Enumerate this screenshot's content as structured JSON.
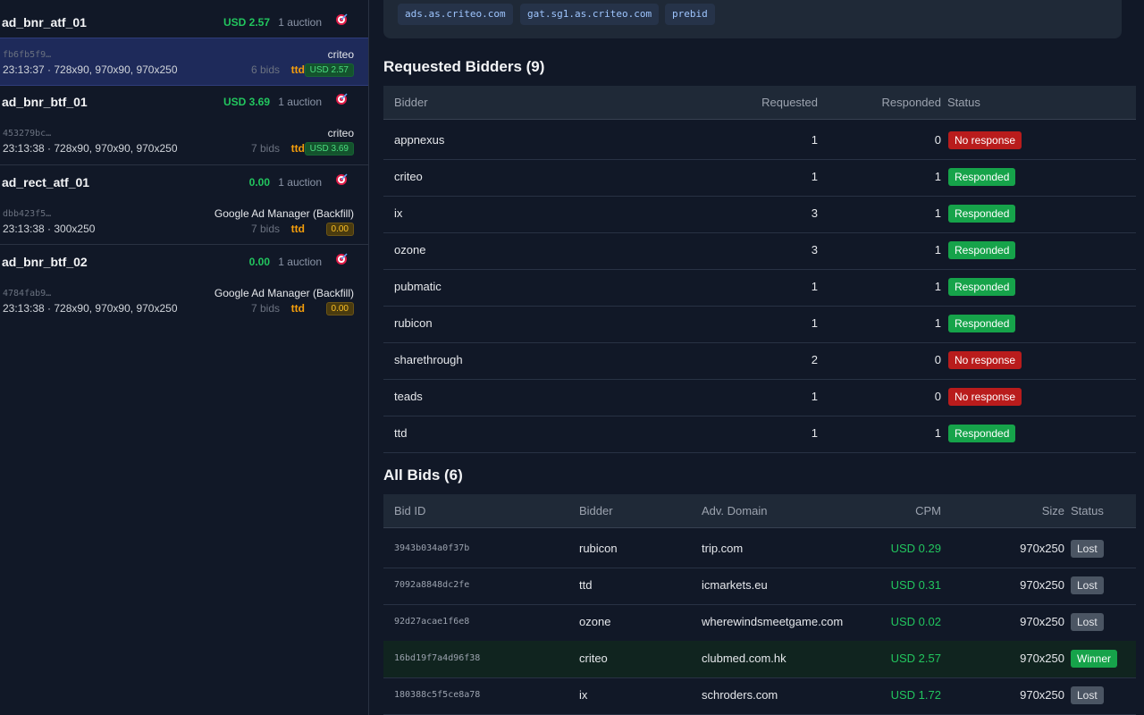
{
  "colors": {
    "background": "#111827",
    "panel": "#1f2937",
    "selected": "#1e2a5a",
    "accent_green": "#22c55e",
    "accent_orange": "#f59e0b",
    "danger": "#b91c1c"
  },
  "sidebar": {
    "slots": [
      {
        "name": "ad_bnr_atf_01",
        "price": "USD 2.57",
        "auctions": "1 auction",
        "icon": "target-icon",
        "auction": {
          "id": "fb6fb5f9…",
          "winner": "criteo",
          "meta": "23:13:37 · 728x90, 970x90, 970x250",
          "bids": "6 bids",
          "top_bidder": "ttd",
          "top_value": "USD 2.57"
        }
      },
      {
        "name": "ad_bnr_btf_01",
        "price": "USD 3.69",
        "auctions": "1 auction",
        "icon": "target-icon",
        "auction": {
          "id": "453279bc…",
          "winner": "criteo",
          "meta": "23:13:38 · 728x90, 970x90, 970x250",
          "bids": "7 bids",
          "top_bidder": "ttd",
          "top_value": "USD 3.69"
        }
      },
      {
        "name": "ad_rect_atf_01",
        "price": "0.00",
        "auctions": "1 auction",
        "icon": "target-icon",
        "auction": {
          "id": "dbb423f5…",
          "winner": "Google Ad Manager (Backfill)",
          "meta": "23:13:38 · 300x250",
          "bids": "7 bids",
          "top_bidder": "ttd",
          "top_value": "0.00"
        }
      },
      {
        "name": "ad_bnr_btf_02",
        "price": "0.00",
        "auctions": "1 auction",
        "icon": "target-icon",
        "auction": {
          "id": "4784fab9…",
          "winner": "Google Ad Manager (Backfill)",
          "meta": "23:13:38 · 728x90, 970x90, 970x250",
          "bids": "7 bids",
          "top_bidder": "ttd",
          "top_value": "0.00"
        }
      }
    ]
  },
  "domains": [
    "ads.as.criteo.com",
    "gat.sg1.as.criteo.com",
    "prebid"
  ],
  "requested_bidders": {
    "title": "Requested Bidders (9)",
    "headers": {
      "bidder": "Bidder",
      "requested": "Requested",
      "responded": "Responded",
      "status": "Status"
    },
    "rows": [
      {
        "bidder": "appnexus",
        "requested": "1",
        "responded": "0",
        "status": "No response",
        "ok": false
      },
      {
        "bidder": "criteo",
        "requested": "1",
        "responded": "1",
        "status": "Responded",
        "ok": true
      },
      {
        "bidder": "ix",
        "requested": "3",
        "responded": "1",
        "status": "Responded",
        "ok": true
      },
      {
        "bidder": "ozone",
        "requested": "3",
        "responded": "1",
        "status": "Responded",
        "ok": true
      },
      {
        "bidder": "pubmatic",
        "requested": "1",
        "responded": "1",
        "status": "Responded",
        "ok": true
      },
      {
        "bidder": "rubicon",
        "requested": "1",
        "responded": "1",
        "status": "Responded",
        "ok": true
      },
      {
        "bidder": "sharethrough",
        "requested": "2",
        "responded": "0",
        "status": "No response",
        "ok": false
      },
      {
        "bidder": "teads",
        "requested": "1",
        "responded": "0",
        "status": "No response",
        "ok": false
      },
      {
        "bidder": "ttd",
        "requested": "1",
        "responded": "1",
        "status": "Responded",
        "ok": true
      }
    ]
  },
  "all_bids": {
    "title": "All Bids (6)",
    "headers": {
      "bid_id": "Bid ID",
      "bidder": "Bidder",
      "domain": "Adv. Domain",
      "cpm": "CPM",
      "size": "Size",
      "status": "Status"
    },
    "rows": [
      {
        "bid_id": "3943b034a0f37b",
        "bidder": "rubicon",
        "domain": "trip.com",
        "cpm": "USD 0.29",
        "size": "970x250",
        "status": "Lost",
        "winner": false
      },
      {
        "bid_id": "7092a8848dc2fe",
        "bidder": "ttd",
        "domain": "icmarkets.eu",
        "cpm": "USD 0.31",
        "size": "970x250",
        "status": "Lost",
        "winner": false
      },
      {
        "bid_id": "92d27acae1f6e8",
        "bidder": "ozone",
        "domain": "wherewindsmeetgame.com",
        "cpm": "USD 0.02",
        "size": "970x250",
        "status": "Lost",
        "winner": false
      },
      {
        "bid_id": "16bd19f7a4d96f38",
        "bidder": "criteo",
        "domain": "clubmed.com.hk",
        "cpm": "USD 2.57",
        "size": "970x250",
        "status": "Winner",
        "winner": true
      },
      {
        "bid_id": "180388c5f5ce8a78",
        "bidder": "ix",
        "domain": "schroders.com",
        "cpm": "USD 1.72",
        "size": "970x250",
        "status": "Lost",
        "winner": false
      }
    ]
  }
}
